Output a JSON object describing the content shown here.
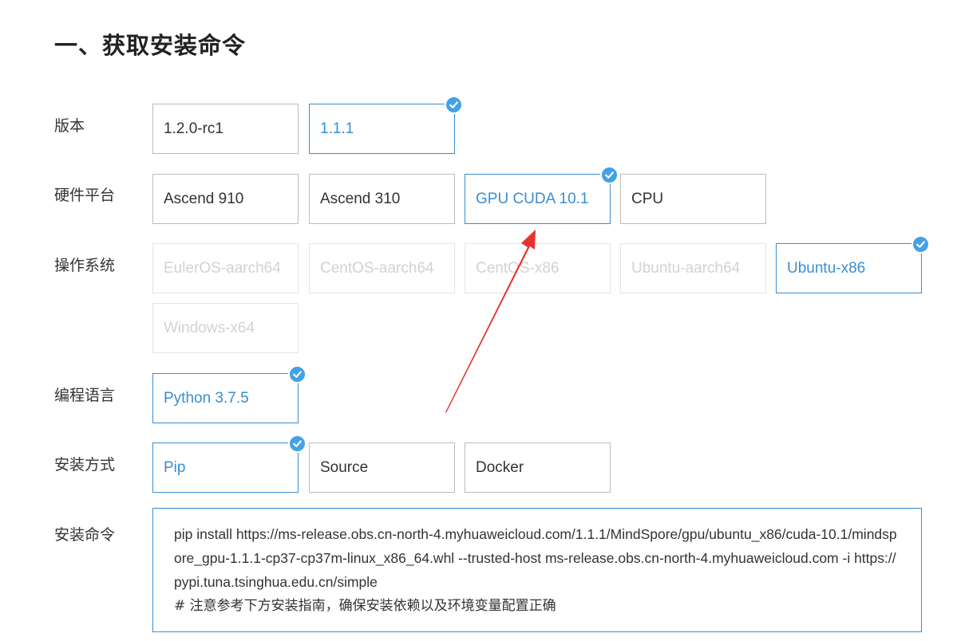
{
  "section_title": "一、获取安装命令",
  "rows": {
    "version": {
      "label": "版本",
      "options": [
        {
          "text": "1.2.0-rc1",
          "state": "normal"
        },
        {
          "text": "1.1.1",
          "state": "selected"
        }
      ]
    },
    "hardware": {
      "label": "硬件平台",
      "options": [
        {
          "text": "Ascend 910",
          "state": "normal"
        },
        {
          "text": "Ascend 310",
          "state": "normal"
        },
        {
          "text": "GPU CUDA 10.1",
          "state": "selected"
        },
        {
          "text": "CPU",
          "state": "normal"
        }
      ]
    },
    "os": {
      "label": "操作系统",
      "options": [
        {
          "text": "EulerOS-aarch64",
          "state": "disabled"
        },
        {
          "text": "CentOS-aarch64",
          "state": "disabled"
        },
        {
          "text": "CentOS-x86",
          "state": "disabled"
        },
        {
          "text": "Ubuntu-aarch64",
          "state": "disabled"
        },
        {
          "text": "Ubuntu-x86",
          "state": "selected"
        },
        {
          "text": "Windows-x64",
          "state": "disabled"
        }
      ]
    },
    "language": {
      "label": "编程语言",
      "options": [
        {
          "text": "Python 3.7.5",
          "state": "selected"
        }
      ]
    },
    "install_method": {
      "label": "安装方式",
      "options": [
        {
          "text": "Pip",
          "state": "selected"
        },
        {
          "text": "Source",
          "state": "normal"
        },
        {
          "text": "Docker",
          "state": "normal"
        }
      ]
    },
    "command": {
      "label": "安装命令",
      "text": "pip install https://ms-release.obs.cn-north-4.myhuaweicloud.com/1.1.1/MindSpore/gpu/ubuntu_x86/cuda-10.1/mindspore_gpu-1.1.1-cp37-cp37m-linux_x86_64.whl --trusted-host ms-release.obs.cn-north-4.myhuaweicloud.com -i https://pypi.tuna.tsinghua.edu.cn/simple",
      "comment": "# 注意参考下方安装指南，确保安装依赖以及环境变量配置正确"
    }
  },
  "colors": {
    "selected": "#3a8ed0",
    "check_badge": "#43a1e8",
    "annotation_arrow": "#e8322b",
    "disabled_text": "#d2d2d2"
  },
  "icons": {
    "check": "check-icon"
  }
}
